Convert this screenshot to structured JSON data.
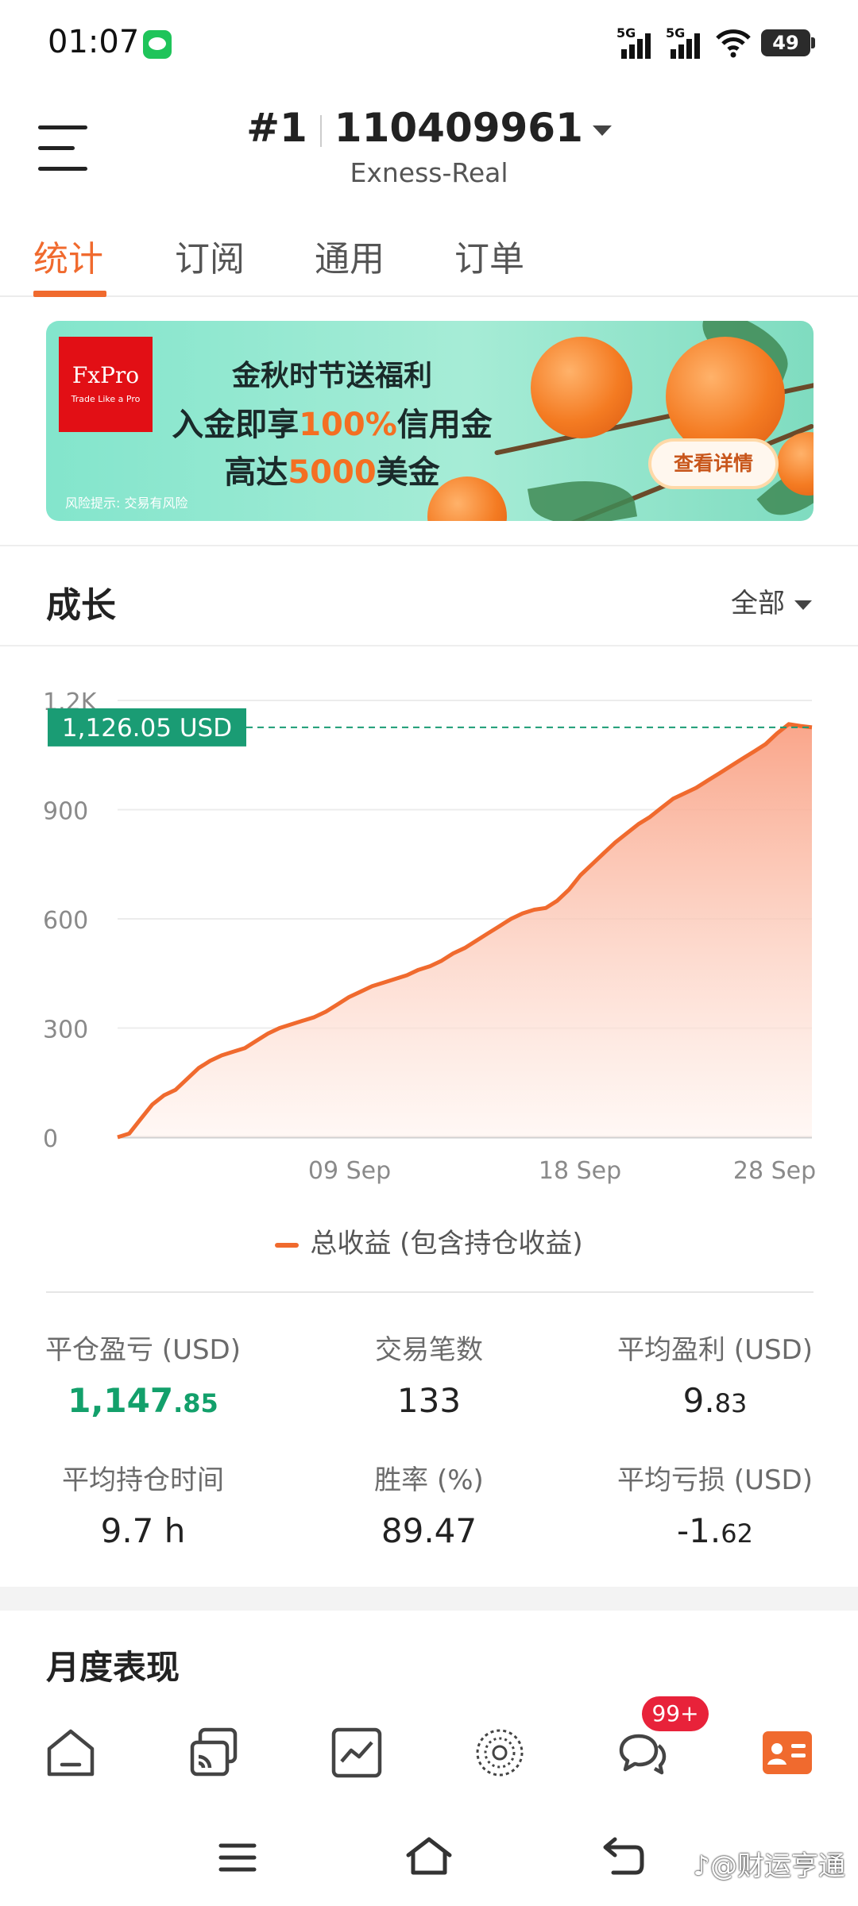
{
  "status_bar": {
    "time": "01:07",
    "signal_1": "5G",
    "signal_2": "5G",
    "battery": "49"
  },
  "header": {
    "account_prefix": "#1",
    "account_number": "110409961",
    "server": "Exness-Real"
  },
  "tabs": [
    {
      "label": "统计",
      "active": true
    },
    {
      "label": "订阅",
      "active": false
    },
    {
      "label": "通用",
      "active": false
    },
    {
      "label": "订单",
      "active": false
    }
  ],
  "banner": {
    "brand": "FxPro",
    "brand_tagline": "Trade Like a Pro",
    "line1": "金秋时节送福利",
    "line2_a": "入金即享",
    "line2_b": "100%",
    "line2_c": "信用金",
    "line3_a": "高达",
    "line3_b": "5000",
    "line3_c": "美金",
    "risk": "风险提示: 交易有风险",
    "button": "查看详情"
  },
  "growth": {
    "title": "成长",
    "filter": "全部",
    "current_value_label": "1,126.05 USD",
    "legend": "总收益 (包含持仓收益)"
  },
  "chart_data": {
    "type": "area",
    "y_ticks": [
      "0",
      "300",
      "600",
      "900",
      "1.2K"
    ],
    "x_ticks": [
      "09 Sep",
      "18 Sep",
      "28 Sep"
    ],
    "ylim": [
      0,
      1200
    ],
    "series": [
      {
        "name": "总收益 (包含持仓收益)",
        "values": [
          0,
          10,
          50,
          90,
          115,
          130,
          160,
          190,
          210,
          225,
          235,
          245,
          265,
          285,
          300,
          310,
          320,
          330,
          345,
          365,
          385,
          400,
          415,
          425,
          435,
          445,
          460,
          470,
          485,
          505,
          520,
          540,
          560,
          580,
          600,
          615,
          625,
          630,
          650,
          680,
          720,
          750,
          780,
          810,
          835,
          860,
          880,
          905,
          930,
          945,
          960,
          980,
          1000,
          1020,
          1040,
          1060,
          1080,
          1110,
          1135,
          1130,
          1126
        ]
      }
    ],
    "current_value": 1126.05,
    "grid": true,
    "colors": {
      "line": "#f06a2e",
      "fill": "#fbb7a0",
      "marker": "#1a9c74"
    }
  },
  "stats": [
    {
      "label": "平仓盈亏 (USD)",
      "int": "1,147",
      "dec": ".85",
      "highlight": true
    },
    {
      "label": "交易笔数",
      "int": "133",
      "dec": "",
      "highlight": false
    },
    {
      "label": "平均盈利 (USD)",
      "int": "9.",
      "dec": "83",
      "highlight": false
    },
    {
      "label": "平均持仓时间",
      "int": "9.7 h",
      "dec": "",
      "highlight": false
    },
    {
      "label": "胜率 (%)",
      "int": "89.47",
      "dec": "",
      "highlight": false
    },
    {
      "label": "平均亏损 (USD)",
      "int": "-1.",
      "dec": "62",
      "highlight": false
    }
  ],
  "monthly": {
    "title": "月度表现"
  },
  "bottom_nav": {
    "items": [
      "home-icon",
      "copy-trade-icon",
      "chart-icon",
      "discover-icon",
      "chat-icon",
      "profile-card-icon"
    ],
    "badge": "99+",
    "active_color": "#f06a2e"
  },
  "watermark": "♪@财运亨通"
}
